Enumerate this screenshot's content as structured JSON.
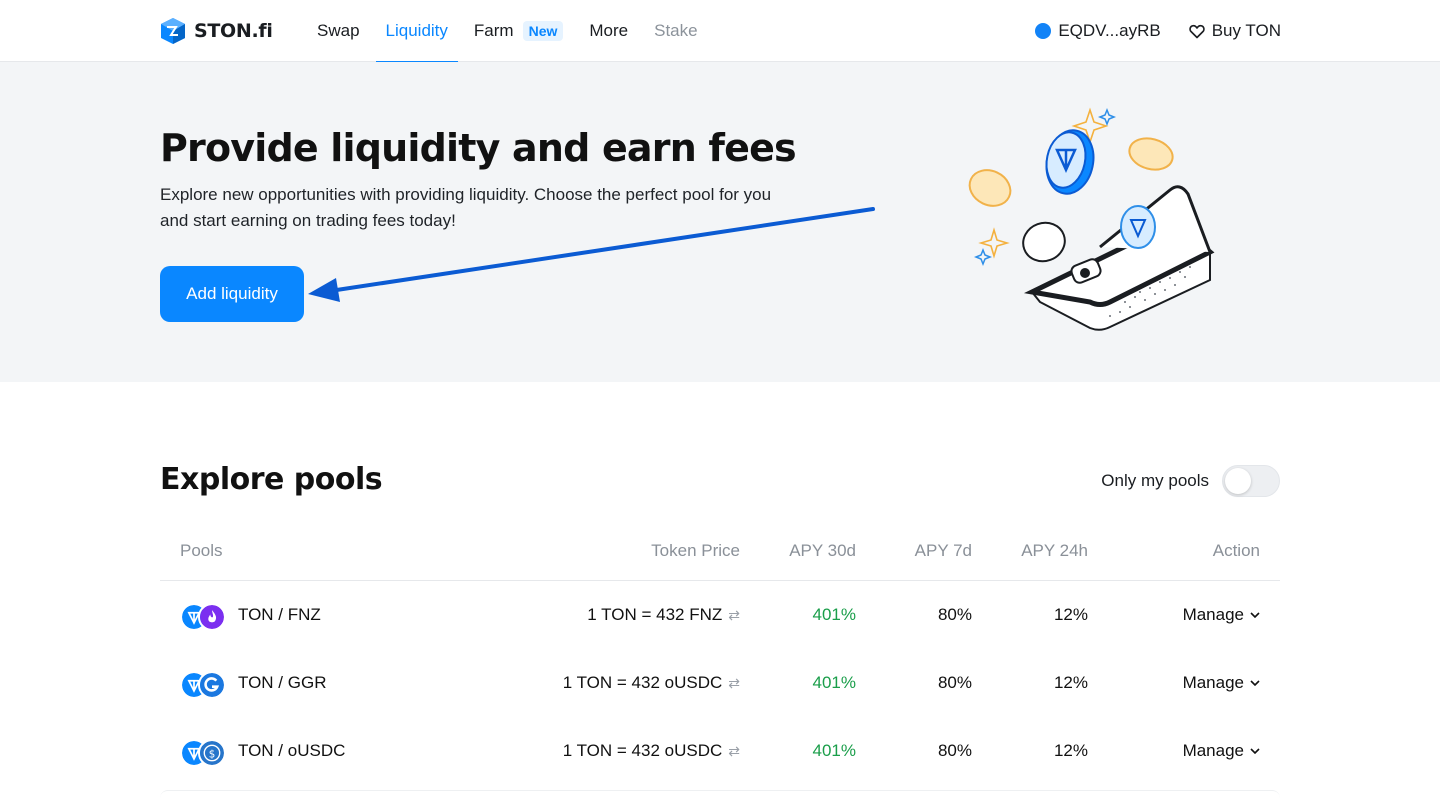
{
  "header": {
    "logo_text": "STON.fi",
    "nav": [
      {
        "label": "Swap"
      },
      {
        "label": "Liquidity"
      },
      {
        "label": "Farm",
        "badge": "New"
      },
      {
        "label": "More"
      },
      {
        "label": "Stake"
      }
    ],
    "wallet": "EQDV...ayRB",
    "buy": "Buy TON",
    "accent": "#0a87ff"
  },
  "hero": {
    "title": "Provide liquidity and earn fees",
    "description": "Explore new opportunities with providing liquidity. Choose the perfect pool for you and start earning on trading fees today!",
    "button": "Add liquidity"
  },
  "pools": {
    "title": "Explore pools",
    "only_mine_label": "Only my pools",
    "only_mine_on": false,
    "columns": [
      "Pools",
      "Token Price",
      "APY 30d",
      "APY 7d",
      "APY 24h",
      "Action"
    ],
    "rows": [
      {
        "pair": "TON / FNZ",
        "price": "1 TON = 432 FNZ",
        "apy30": "401%",
        "apy7": "80%",
        "apy24": "12%",
        "action": "Manage",
        "icon": "fnz-icon"
      },
      {
        "pair": "TON / GGR",
        "price": "1 TON = 432 oUSDC",
        "apy30": "401%",
        "apy7": "80%",
        "apy24": "12%",
        "action": "Manage",
        "icon": "ggr-icon"
      },
      {
        "pair": "TON / oUSDC",
        "price": "1 TON = 432 oUSDC",
        "apy30": "401%",
        "apy7": "80%",
        "apy24": "12%",
        "action": "Manage",
        "icon": "usdc-icon"
      }
    ]
  }
}
